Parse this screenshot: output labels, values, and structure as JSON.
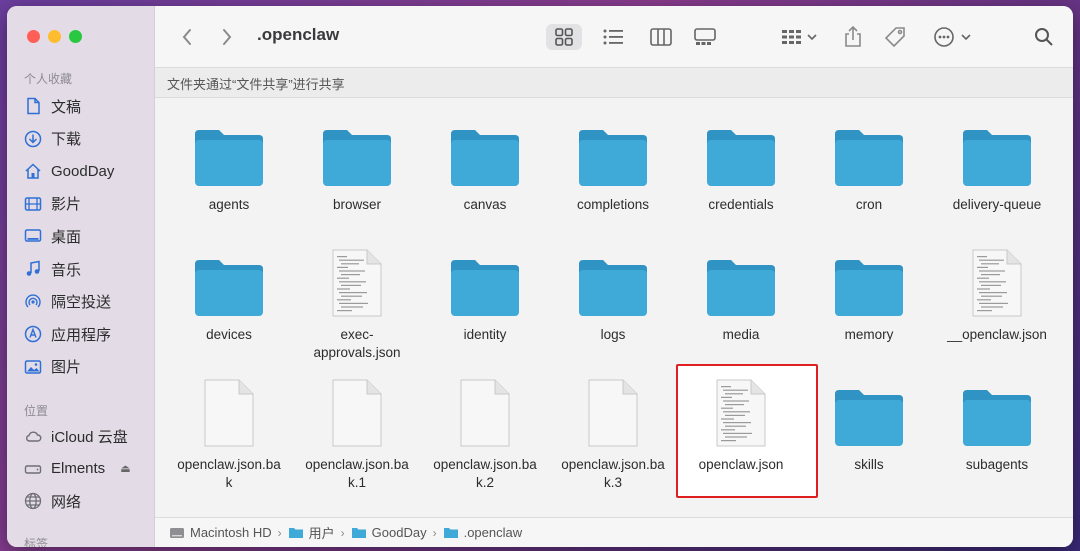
{
  "window": {
    "title": ".openclaw"
  },
  "sidebar": {
    "favorites_label": "个人收藏",
    "favorites": [
      {
        "label": "文稿",
        "icon": "document-icon"
      },
      {
        "label": "下载",
        "icon": "download-icon"
      },
      {
        "label": "GoodDay",
        "icon": "home-icon"
      },
      {
        "label": "影片",
        "icon": "film-icon"
      },
      {
        "label": "桌面",
        "icon": "desktop-icon"
      },
      {
        "label": "音乐",
        "icon": "music-icon"
      },
      {
        "label": "隔空投送",
        "icon": "airdrop-icon"
      },
      {
        "label": "应用程序",
        "icon": "apps-icon"
      },
      {
        "label": "图片",
        "icon": "photo-icon"
      }
    ],
    "locations_label": "位置",
    "locations": [
      {
        "label": "iCloud 云盘",
        "icon": "cloud-icon"
      },
      {
        "label": "Elments",
        "icon": "disk-icon"
      },
      {
        "label": "网络",
        "icon": "globe-icon"
      }
    ],
    "tags_label": "标签"
  },
  "banner": {
    "text": "文件夹通过“文件共享”进行共享"
  },
  "files": [
    {
      "name": "agents",
      "kind": "folder"
    },
    {
      "name": "browser",
      "kind": "folder"
    },
    {
      "name": "canvas",
      "kind": "folder"
    },
    {
      "name": "completions",
      "kind": "folder"
    },
    {
      "name": "credentials",
      "kind": "folder"
    },
    {
      "name": "cron",
      "kind": "folder"
    },
    {
      "name": "delivery-queue",
      "kind": "folder"
    },
    {
      "name": "devices",
      "kind": "folder"
    },
    {
      "name": "exec-\napprovals.json",
      "kind": "textdoc"
    },
    {
      "name": "identity",
      "kind": "folder"
    },
    {
      "name": "logs",
      "kind": "folder"
    },
    {
      "name": "media",
      "kind": "folder"
    },
    {
      "name": "memory",
      "kind": "folder"
    },
    {
      "name": "__openclaw.json",
      "kind": "textdoc"
    },
    {
      "name": "openclaw.json.ba\nk",
      "kind": "blankdoc"
    },
    {
      "name": "openclaw.json.ba\nk.1",
      "kind": "blankdoc"
    },
    {
      "name": "openclaw.json.ba\nk.2",
      "kind": "blankdoc"
    },
    {
      "name": "openclaw.json.ba\nk.3",
      "kind": "blankdoc"
    },
    {
      "name": "openclaw.json",
      "kind": "textdoc",
      "selected": true
    },
    {
      "name": "skills",
      "kind": "folder"
    },
    {
      "name": "subagents",
      "kind": "folder"
    }
  ],
  "pathbar": [
    {
      "label": "Macintosh HD",
      "icon": "hd-icon"
    },
    {
      "label": "用户",
      "icon": "folder-icon"
    },
    {
      "label": "GoodDay",
      "icon": "folder-icon"
    },
    {
      "label": ".openclaw",
      "icon": "folder-icon"
    }
  ],
  "colors": {
    "folder": "#3fa9d8",
    "folder_tab": "#2f94c4",
    "highlight": "#e02020"
  }
}
